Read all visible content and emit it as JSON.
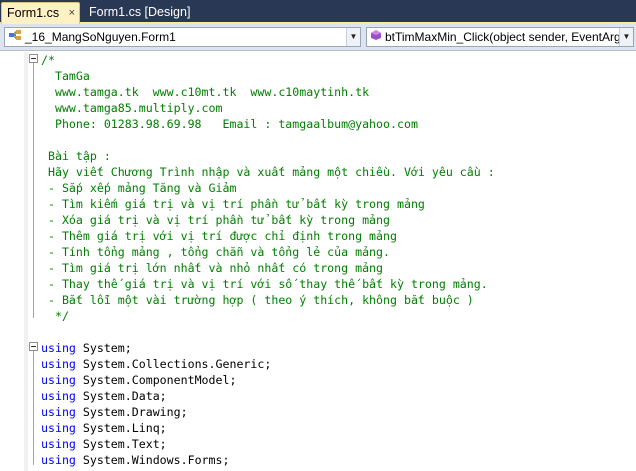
{
  "tabs": [
    {
      "label": "Form1.cs",
      "close": "×",
      "active": true
    },
    {
      "label": "Form1.cs [Design]",
      "active": false
    }
  ],
  "navbar": {
    "class_combo": "_16_MangSoNguyen.Form1",
    "member_combo": "btTimMaxMin_Click(object sender, EventArgs e)"
  },
  "code": {
    "comment_lines": [
      "/*",
      "  TamGa",
      "  www.tamga.tk  www.c10mt.tk  www.c10maytinh.tk",
      "  www.tamga85.multiply.com",
      "  Phone: 01283.98.69.98   Email : tamgaalbum@yahoo.com",
      "",
      " Bài tập :",
      " Hãy viết Chương Trình nhập và xuất mảng một chiều. Với yêu cầu :",
      " - Sắp xếp mảng Tăng và Giảm",
      " - Tìm kiếm giá trị và vị trí phần tử bất kỳ trong mảng",
      " - Xóa giá trị và vị trí phần tử bất kỳ trong mảng",
      " - Thêm giá trị với vị trí được chỉ định trong mảng",
      " - Tính tổng mảng , tổng chẵn và tổng lẻ của mảng.",
      " - Tìm giá trị lớn nhất và nhỏ nhất có trong mảng",
      " - Thay thế giá trị và vị trí với số thay thế bất kỳ trong mảng.",
      " - Bắt lỗi một vài trường hợp ( theo ý thích, không bắt buộc )",
      "  */"
    ],
    "using_keyword": "using",
    "usings": [
      "System;",
      "System.Collections.Generic;",
      "System.ComponentModel;",
      "System.Data;",
      "System.Drawing;",
      "System.Linq;",
      "System.Text;",
      "System.Windows.Forms;"
    ]
  },
  "colors": {
    "comment": "#008000",
    "keyword": "#0000ff",
    "tabbar": "#293955",
    "active_tab": "#fff1c4"
  },
  "icons": {
    "class_combo": "csharp-class-icon",
    "member_combo": "method-icon"
  }
}
